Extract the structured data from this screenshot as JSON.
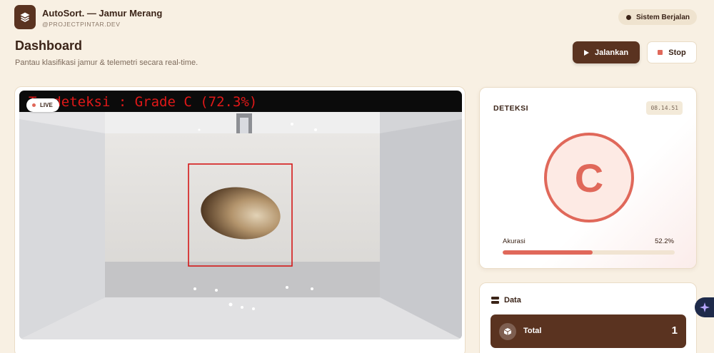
{
  "app": {
    "title": "AutoSort. — Jamur Merang",
    "subtitle": "@PROJECTPINTAR.DEV",
    "logo_icon": "layers-icon",
    "status": "Sistem Berjalan"
  },
  "header": {
    "title": "Dashboard",
    "subtitle": "Pantau klasifikasi jamur & telemetri secara real-time.",
    "run_label": "Jalankan",
    "stop_label": "Stop"
  },
  "camera": {
    "overlay_text": "Terdeteksi : Grade C (72.3%)",
    "live_label": "LIVE"
  },
  "detection": {
    "title": "DETEKSI",
    "time": "08.14.51",
    "grade": "C",
    "accuracy_label": "Akurasi",
    "accuracy_value": "52.2%",
    "accuracy_fraction": 0.522,
    "accent_color": "#e0685a"
  },
  "data": {
    "title": "Data",
    "total_label": "Total",
    "total_value": "1"
  },
  "colors": {
    "background": "#f8f0e3",
    "brand": "#5a3320",
    "accent": "#e0685a"
  }
}
